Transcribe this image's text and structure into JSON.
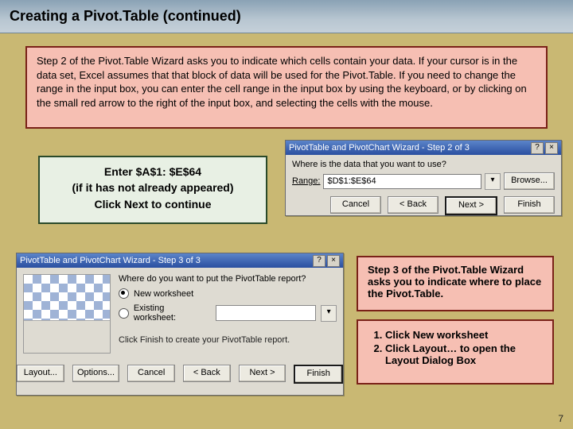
{
  "title": "Creating a Pivot.Table (continued)",
  "instructions": "Step 2 of the Pivot.Table Wizard asks you to indicate which cells contain your data. If your cursor is in the data set, Excel assumes that that block of data will be used for the Pivot.Table.  If you need to change the range in the input box, you can enter the cell range in the input box by using the keyboard, or by clicking on the small red arrow to the right of the input box, and selecting the cells with the mouse.",
  "enter_box": {
    "line1": "Enter $A$1: $E$64",
    "line2": "(if it has not already appeared)",
    "line3": "Click Next to continue"
  },
  "wizard2": {
    "title": "PivotTable and PivotChart Wizard - Step 2 of 3",
    "question": "Where is the data that you want to use?",
    "range_label": "Range:",
    "range_value": "$D$1:$E$64",
    "browse": "Browse...",
    "cancel": "Cancel",
    "back": "< Back",
    "next": "Next >",
    "finish": "Finish"
  },
  "wizard3": {
    "title": "PivotTable and PivotChart Wizard - Step 3 of 3",
    "question": "Where do you want to put the PivotTable report?",
    "opt_new": "New worksheet",
    "opt_existing": "Existing worksheet:",
    "existing_value": "",
    "hint": "Click Finish to create your PivotTable report.",
    "layout": "Layout...",
    "options": "Options...",
    "cancel": "Cancel",
    "back": "< Back",
    "next": "Next >",
    "finish": "Finish"
  },
  "step3_text": "Step 3 of the Pivot.Table Wizard asks you to indicate where to place the Pivot.Table.",
  "step3_list": {
    "i1": "Click New worksheet",
    "i2": "Click Layout… to open the Layout Dialog Box"
  },
  "page_number": "7"
}
